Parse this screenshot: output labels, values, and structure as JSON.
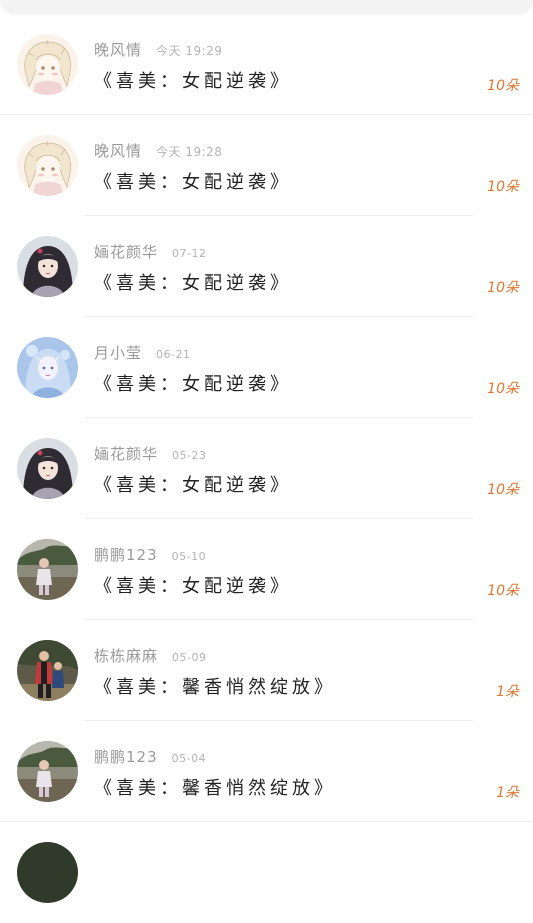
{
  "colors": {
    "accent_orange": "#e4762f",
    "name_gray": "#9a9a9a",
    "time_gray": "#b4b4b4",
    "text_dark": "#222222"
  },
  "items": [
    {
      "name": "晚风情",
      "time": "今天 19:29",
      "gift": "《喜美：女配逆袭》",
      "count": "10朵",
      "avatar": "anime-girl-sketch"
    },
    {
      "name": "晚风情",
      "time": "今天 19:28",
      "gift": "《喜美：女配逆袭》",
      "count": "10朵",
      "avatar": "anime-girl-sketch"
    },
    {
      "name": "婳花颜华",
      "time": "07-12",
      "gift": "《喜美：女配逆袭》",
      "count": "10朵",
      "avatar": "ancient-style-girl"
    },
    {
      "name": "月小莹",
      "time": "06-21",
      "gift": "《喜美：女配逆袭》",
      "count": "10朵",
      "avatar": "blue-fantasy-girl"
    },
    {
      "name": "婳花颜华",
      "time": "05-23",
      "gift": "《喜美：女配逆袭》",
      "count": "10朵",
      "avatar": "ancient-style-girl"
    },
    {
      "name": "鹏鹏123",
      "time": "05-10",
      "gift": "《喜美：女配逆袭》",
      "count": "10朵",
      "avatar": "child-photo"
    },
    {
      "name": "栋栋麻麻",
      "time": "05-09",
      "gift": "《喜美：馨香悄然绽放》",
      "count": "1朵",
      "avatar": "family-photo"
    },
    {
      "name": "鹏鹏123",
      "time": "05-04",
      "gift": "《喜美：馨香悄然绽放》",
      "count": "1朵",
      "avatar": "child-photo"
    }
  ]
}
